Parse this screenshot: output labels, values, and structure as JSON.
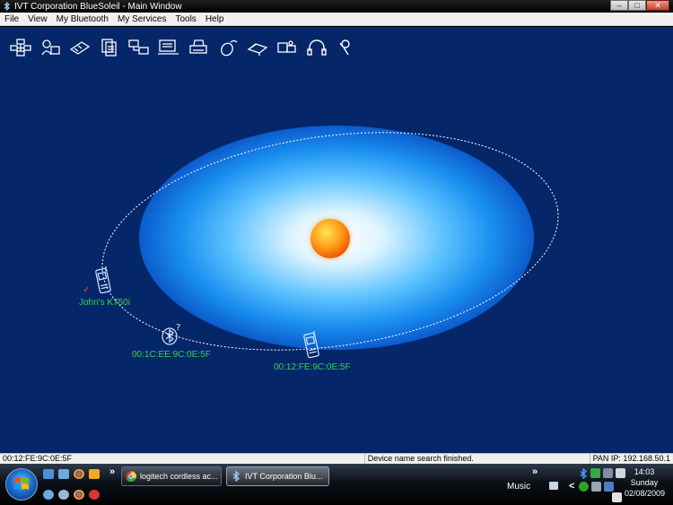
{
  "window": {
    "title": "IVT Corporation BlueSoleil - Main Window",
    "controls": {
      "minimize": "–",
      "maximize": "□",
      "close": "✕"
    }
  },
  "menu": {
    "items": [
      "File",
      "View",
      "My Bluetooth",
      "My Services",
      "Tools",
      "Help"
    ]
  },
  "toolbar": {
    "icons": [
      "network-service-icon",
      "personal-area-network-icon",
      "dial-up-networking-icon",
      "file-transfer-icon",
      "lan-access-icon",
      "fax-icon",
      "printer-icon",
      "mouse-icon",
      "synchronization-icon",
      "serial-port-icon",
      "headset-icon",
      "audio-gateway-icon"
    ]
  },
  "devices": [
    {
      "label": "John's K750i",
      "icon": "mobile-phone-icon",
      "connected": true
    },
    {
      "label": "00:1C:EE:9C:0E:5F",
      "icon": "bluetooth-unknown-device-icon",
      "connected": false
    },
    {
      "label": "00:12:FE:9C:0E:5F",
      "icon": "mobile-phone-icon",
      "connected": false
    }
  ],
  "status": {
    "address": "00:12:FE:9C:0E:5F",
    "message": "Device name search finished.",
    "pan_ip": "PAN IP: 192.168.50.1"
  },
  "taskbar": {
    "quick_launch": [
      "show-desktop-icon",
      "switch-windows-icon",
      "chrome-icon",
      "media-player-icon",
      "search-icon",
      "magnifier-icon",
      "chrome-icon",
      "record-icon"
    ],
    "tasks": [
      {
        "label": "logitech cordless ac...",
        "icon": "chrome-icon",
        "active": false
      },
      {
        "label": "IVT Corporation Blu...",
        "icon": "bluetooth-icon",
        "active": true
      }
    ],
    "toolbar_label": "Music",
    "overflow": "»",
    "tray_expand": "<"
  },
  "clock": {
    "time": "14:03",
    "day": "Sunday",
    "date": "02/08/2009"
  },
  "colors": {
    "canvas": "#052668",
    "device_label": "#39d352",
    "orbit": "#ffffff"
  }
}
